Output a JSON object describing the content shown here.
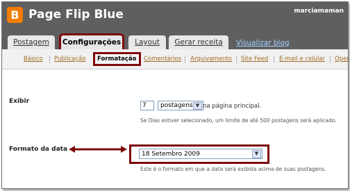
{
  "header": {
    "blog_title": "Page Flip Blue",
    "username": "marciamaman",
    "logo_letter": "B"
  },
  "main_tabs": [
    {
      "label": "Postagem"
    },
    {
      "label": "Configurações"
    },
    {
      "label": "Layout"
    },
    {
      "label": "Gerar receita"
    }
  ],
  "view_blog": "Visualizar blog",
  "sub_tabs": [
    {
      "label": "Básico"
    },
    {
      "label": "Publicação"
    },
    {
      "label": "Formatação"
    },
    {
      "label": "Comentários"
    },
    {
      "label": "Arquivamento"
    },
    {
      "label": "Site Feed"
    },
    {
      "label": "E-mail e celular"
    },
    {
      "label": "Oper"
    }
  ],
  "show_section": {
    "label": "Exibir",
    "count_value": "7",
    "unit_select": "postagens",
    "after_text": "na página principal.",
    "note": "Se Dias estiver selecionado, um limite de até 500 postagens será aplicado."
  },
  "date_section": {
    "label": "Formato da data",
    "selected": "18 Setembro 2009",
    "note": "Este é o formato em que a data será exibida acima de suas postagens."
  },
  "colors": {
    "highlight": "#7d0a0a",
    "top_bar": "#5f5f5f",
    "blogger_orange": "#f57d00",
    "link_brown": "#a06a24"
  }
}
